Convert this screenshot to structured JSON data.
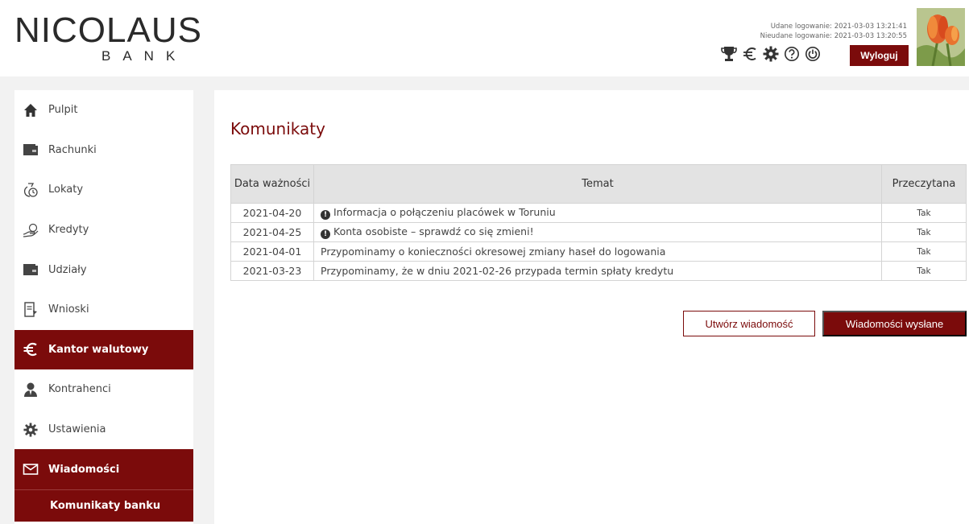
{
  "header": {
    "logo_main": "NICOLAUS",
    "logo_sub": "BANK",
    "last_login_success": "Udane logowanie: 2021-03-03 13:21:41",
    "last_login_failed": "Nieudane logowanie: 2021-03-03 13:20:55",
    "icons": [
      "trophy-icon",
      "euro-icon",
      "gear-icon",
      "help-icon",
      "power-icon"
    ],
    "logout_label": "Wyloguj"
  },
  "sidebar": {
    "items": [
      {
        "label": "Pulpit",
        "icon": "home-icon"
      },
      {
        "label": "Rachunki",
        "icon": "wallet-icon"
      },
      {
        "label": "Lokaty",
        "icon": "deposit-icon"
      },
      {
        "label": "Kredyty",
        "icon": "credit-icon"
      },
      {
        "label": "Udziały",
        "icon": "shares-icon"
      },
      {
        "label": "Wnioski",
        "icon": "application-icon"
      },
      {
        "label": "Kantor walutowy",
        "icon": "euro-icon"
      },
      {
        "label": "Kontrahenci",
        "icon": "person-icon"
      },
      {
        "label": "Ustawienia",
        "icon": "gear-icon"
      },
      {
        "label": "Wiadomości",
        "icon": "envelope-icon"
      }
    ],
    "subitem": "Komunikaty banku"
  },
  "main": {
    "title": "Komunikaty",
    "table": {
      "headers": [
        "Data ważności",
        "Temat",
        "Przeczytana"
      ],
      "rows": [
        {
          "date": "2021-04-20",
          "subject": "Informacja o połączeniu placówek w Toruniu",
          "read": "Tak",
          "important": true
        },
        {
          "date": "2021-04-25",
          "subject": "Konta osobiste – sprawdź co się zmieni!",
          "read": "Tak",
          "important": true
        },
        {
          "date": "2021-04-01",
          "subject": "Przypominamy o konieczności okresowej zmiany haseł do logowania",
          "read": "Tak",
          "important": false
        },
        {
          "date": "2021-03-23",
          "subject": "Przypominamy, że w dniu 2021-02-26 przypada termin spłaty kredytu",
          "read": "Tak",
          "important": false
        }
      ]
    },
    "create_button": "Utwórz wiadomość",
    "sent_button": "Wiadomości wysłane"
  },
  "colors": {
    "accent": "#7b0b0b",
    "background": "#f2f2f2",
    "table_header": "#e3e3e3"
  }
}
